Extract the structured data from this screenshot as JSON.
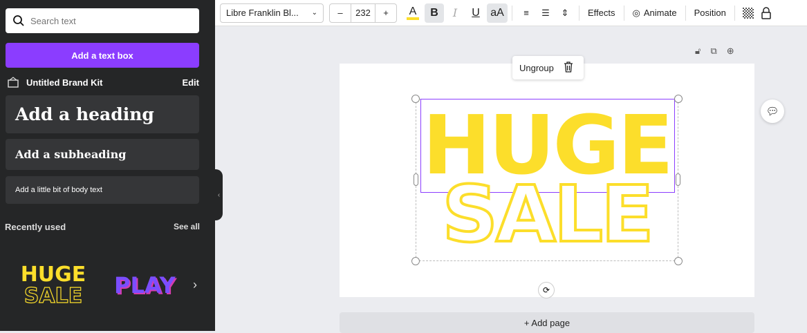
{
  "sidebar": {
    "search_placeholder": "Search text",
    "add_text_box": "Add a text box",
    "brand_kit": "Untitled Brand Kit",
    "edit": "Edit",
    "heading": "Add a heading",
    "subheading": "Add a subheading",
    "body": "Add a little bit of body text",
    "recently_used": "Recently used",
    "see_all": "See all",
    "recent": [
      {
        "line1": "HUGE",
        "line2": "SALE"
      },
      {
        "line1": "PLAY"
      }
    ]
  },
  "toolbar": {
    "font": "Libre Franklin Bl...",
    "minus": "–",
    "size": "232",
    "plus": "+",
    "text_color_letter": "A",
    "bold": "B",
    "italic": "I",
    "underline": "U",
    "case": "aA",
    "effects": "Effects",
    "animate": "Animate",
    "position": "Position"
  },
  "canvas": {
    "ungroup": "Ungroup",
    "line1": "HUGE",
    "line2": "SALE",
    "add_page": "+ Add page"
  },
  "colors": {
    "accent": "#8b3dff",
    "yellow": "#fcde2b"
  }
}
